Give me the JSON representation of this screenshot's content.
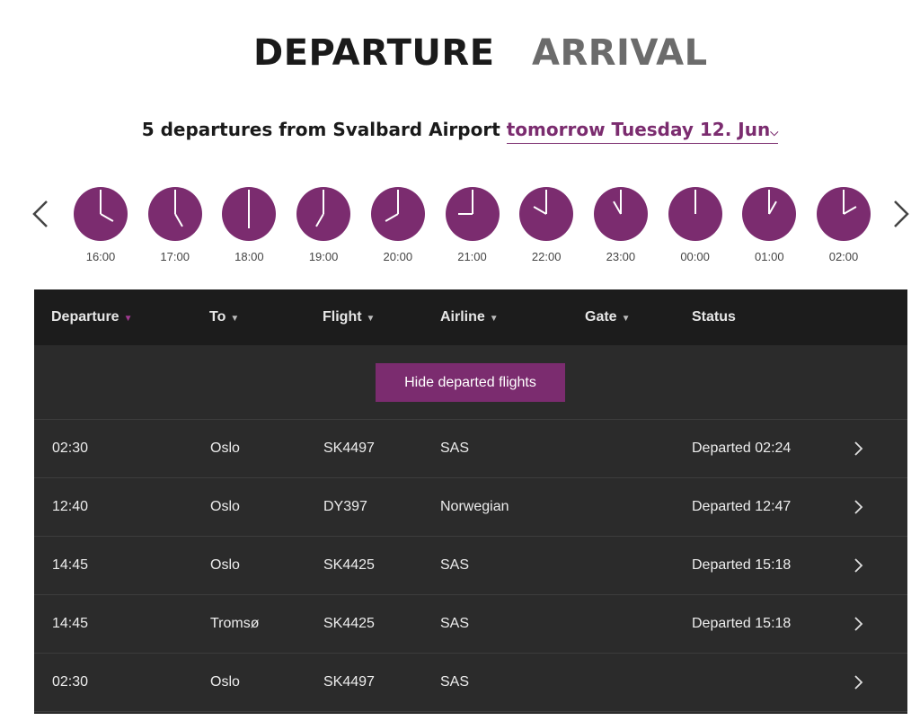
{
  "tabs": {
    "departure": "DEPARTURE",
    "arrival": "ARRIVAL"
  },
  "subtitle": {
    "prefix": "5 departures from Svalbard Airport",
    "date": "tomorrow Tuesday 12. Jun"
  },
  "colors": {
    "accent": "#7b2c6f",
    "header_bg": "#1c1c1c",
    "table_bg": "#2b2b2b"
  },
  "timeline": {
    "prev_icon": "chevron-left-icon",
    "next_icon": "chevron-right-icon",
    "slots": [
      "16:00",
      "17:00",
      "18:00",
      "19:00",
      "20:00",
      "21:00",
      "22:00",
      "23:00",
      "00:00",
      "01:00",
      "02:00"
    ]
  },
  "table": {
    "headers": {
      "departure": "Departure",
      "to": "To",
      "flight": "Flight",
      "airline": "Airline",
      "gate": "Gate",
      "status": "Status"
    },
    "hide_button": "Hide departed flights",
    "rows": [
      {
        "time": "02:30",
        "to": "Oslo",
        "flight": "SK4497",
        "airline": "SAS",
        "gate": "",
        "status": "Departed 02:24"
      },
      {
        "time": "12:40",
        "to": "Oslo",
        "flight": "DY397",
        "airline": "Norwegian",
        "gate": "",
        "status": "Departed 12:47"
      },
      {
        "time": "14:45",
        "to": "Oslo",
        "flight": "SK4425",
        "airline": "SAS",
        "gate": "",
        "status": "Departed 15:18"
      },
      {
        "time": "14:45",
        "to": "Tromsø",
        "flight": "SK4425",
        "airline": "SAS",
        "gate": "",
        "status": "Departed 15:18"
      },
      {
        "time": "02:30",
        "to": "Oslo",
        "flight": "SK4497",
        "airline": "SAS",
        "gate": "",
        "status": ""
      }
    ]
  }
}
